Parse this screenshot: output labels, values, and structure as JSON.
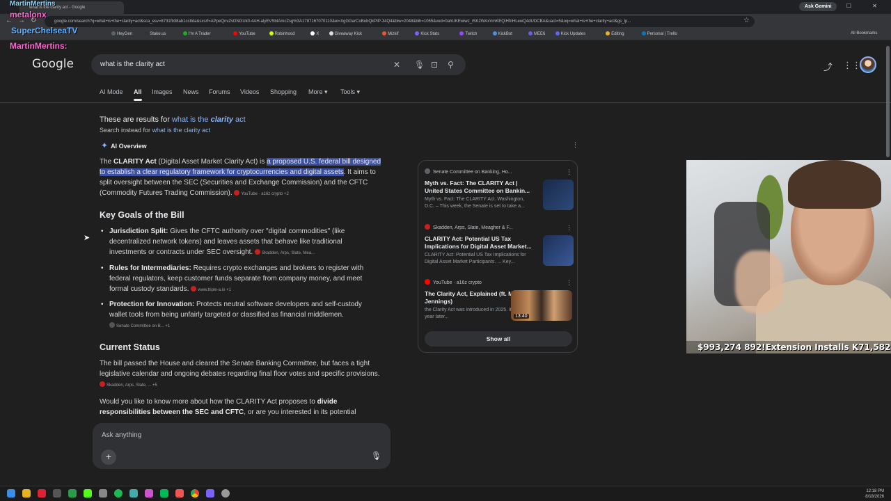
{
  "browser": {
    "tab_title": "what is the clarity act - Google",
    "url": "google.com/search?q=what+is+the+clarity+act&sca_esv=8731fb38ab1cc8da&sxsrf=APpeQnvZvDNGUk0-4AH-alyEVSbIAmcZsg%3A1787167070110&ei=XgGGarCoBubQkPIP-34Q4&biw=2048&bih=1055&ved=0ahUKEwiwz_iSK2WAxVmKEQIHfnHLewQ4dUDCBA&uact=5&oq=what+is+the+clarity+act&gs_lp...",
    "ask_gemini": "Ask Gemini",
    "bookmarks": [
      "HeyGen",
      "Stake.us",
      "I'm A Trader",
      "YouTube",
      "Robinhood",
      "X",
      "Giveaway Kick",
      "Mizkif",
      "Kick Stats",
      "Twitch",
      "KickBot",
      "MEE6",
      "Kick Updates",
      "Editing",
      "Personal | Trello"
    ],
    "all_bookmarks": "All Bookmarks"
  },
  "overlays": {
    "top": "MartinMertins",
    "name1": "metalonx",
    "name2": "SuperChelseaTV",
    "name3": "MartinMertins:"
  },
  "google": {
    "logo": "Google",
    "query": "what is the clarity act",
    "tabs": [
      "AI Mode",
      "All",
      "Images",
      "News",
      "Forums",
      "Videos",
      "Shopping",
      "More",
      "Tools"
    ],
    "active_tab": "All"
  },
  "correction": {
    "prefix": "These are results for",
    "corrected_pre": "what is the ",
    "corrected_em": "clarity",
    "corrected_post": " act",
    "instead_prefix": "Search instead for",
    "instead_link": "what is the clarity act"
  },
  "ai_overview": {
    "label": "AI Overview",
    "intro_bold": "CLARITY Act",
    "intro_pre": "The ",
    "intro_mid": " (Digital Asset Market Clarity Act) is ",
    "intro_hl": "a proposed U.S. federal bill designed to establish a clear regulatory framework for cryptocurrencies and digital assets",
    "intro_post": ". It aims to split oversight between the SEC (Securities and Exchange Commission) and the CFTC (Commodity Futures Trading Commission).",
    "intro_cite": "YouTube · a16z crypto +2",
    "goals_heading": "Key Goals of the Bill",
    "goals": [
      {
        "title": "Jurisdiction Split:",
        "text": " Gives the CFTC authority over \"digital commodities\" (like decentralized network tokens) and leaves assets that behave like traditional investments or contracts under SEC oversight.",
        "cite": "Skadden, Arps, Slate, Mea..."
      },
      {
        "title": "Rules for Intermediaries:",
        "text": " Requires crypto exchanges and brokers to register with federal regulators, keep customer funds separate from company money, and meet formal custody standards.",
        "cite": "www.triple-a.io +1"
      },
      {
        "title": "Protection for Innovation:",
        "text": " Protects neutral software developers and self-custody wallet tools from being unfairly targeted or classified as financial middlemen.",
        "cite": "Senate Committee on B... +1"
      }
    ],
    "status_heading": "Current Status",
    "status_text": "The bill passed the House and cleared the Senate Banking Committee, but faces a tight legislative calendar and ongoing debates regarding final floor votes and specific provisions.",
    "status_cite": "Skadden, Arps, Slate, ...",
    "status_cite_more": "+5",
    "followup_pre": "Would you like to know more about how the CLARITY Act proposes to ",
    "followup_bold": "divide responsibilities between the SEC and CFTC",
    "followup_post": ", or are you interested in its potential"
  },
  "sources": [
    {
      "site": "Senate Committee on Banking, Ho...",
      "title": "Myth vs. Fact: The CLARITY Act | United States Committee on Bankin...",
      "snippet": "Myth vs. Fact: The CLARITY Act. Washington, D.C. – This week, the Senate is set to take a...",
      "color": "#5f6368"
    },
    {
      "site": "Skadden, Arps, Slate, Meagher & F...",
      "title": "CLARITY Act: Potential US Tax Implications for Digital Asset Market...",
      "snippet": "CLARITY Act: Potential US Tax Implications for Digital Asset Market Participants. ... Key...",
      "color": "#c5221f"
    },
    {
      "site": "YouTube · a16z crypto",
      "title": "The Clarity Act, Explained (ft. Miles Jennings)",
      "snippet": "the Clarity Act was introduced in 2025. it's over a year later...",
      "color": "#ff0000",
      "duration": "13:40"
    }
  ],
  "show_all": "Show all",
  "ask_placeholder": "Ask anything",
  "webcam_stats": "$993,274  892!Extension Installs  K71,582",
  "tray": {
    "time": "12:18 PM",
    "date": "8/18/2026"
  }
}
